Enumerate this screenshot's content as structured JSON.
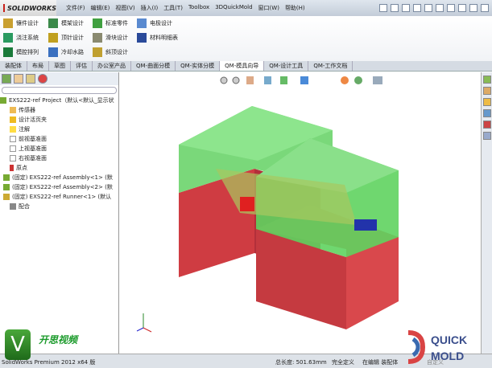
{
  "app": {
    "logo": "SOLIDWORKS",
    "menu": [
      "文件(F)",
      "编辑(E)",
      "视图(V)",
      "插入(I)",
      "工具(T)",
      "Toolbox",
      "3DQuickMold",
      "窗口(W)",
      "帮助(H)"
    ]
  },
  "ribbon": {
    "items": [
      "镶件设计",
      "模架设计",
      "标准零件",
      "电极设计",
      "浇注系统",
      "顶针设计",
      "滑块设计",
      "材料明细表",
      "模腔排列",
      "冷却水路",
      "斜顶设计"
    ]
  },
  "tabs": {
    "items": [
      "装配体",
      "布局",
      "草图",
      "评估",
      "办公室产品",
      "QM-曲面分模",
      "QM-实体分模",
      "QM-模具向导",
      "QM-设计工具",
      "QM-工作文档"
    ],
    "active": "QM-模具向导"
  },
  "tree": {
    "root": "EXS222-ref Project（默认<默认_显示状",
    "items": [
      "传感器",
      "设计活页夹",
      "注解",
      "前视基准面",
      "上视基准面",
      "右视基准面",
      "原点",
      "(固定) EXS222-ref Assembly<1> (默",
      "(固定) EXS222-ref Assembly<2> (默",
      "(固定) EXS222-ref Runner<1> (默认",
      "配合"
    ]
  },
  "status": {
    "product": "SolidWorks Premium 2012 x64 版",
    "length": "总长度: 501.63mm",
    "state": "完全定义",
    "mode": "在编辑 装配体",
    "custom": "自定义"
  },
  "watermark": {
    "v": "V",
    "text": "开思视频",
    "logo": "QUICK MOLD"
  },
  "colors": {
    "green": "#5fd35f",
    "red": "#d9484c"
  }
}
